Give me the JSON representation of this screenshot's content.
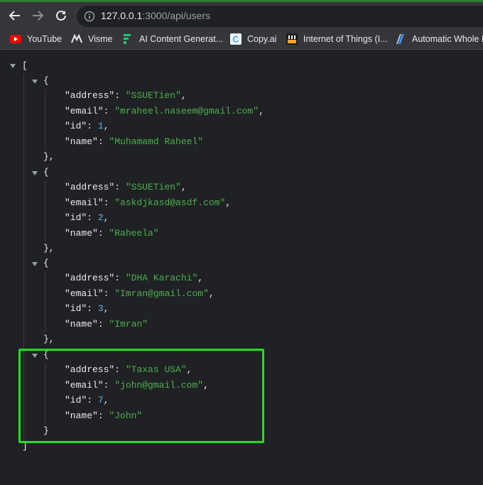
{
  "toolbar": {
    "url_host": "127.0.0.1",
    "url_path": ":3000/api/users"
  },
  "bookmarks": [
    {
      "label": "YouTube",
      "icon": "youtube-icon"
    },
    {
      "label": "Visme",
      "icon": "visme-icon"
    },
    {
      "label": "AI Content Generat...",
      "icon": "ai-content-icon"
    },
    {
      "label": "Copy.ai",
      "icon": "copyai-icon"
    },
    {
      "label": "Internet of Things (I...",
      "icon": "iot-icon"
    },
    {
      "label": "Automatic Whole H",
      "icon": "automatic-icon"
    }
  ],
  "users": [
    {
      "address": "SSUETien",
      "email": "mraheel.naseem@gmail.com",
      "id": "1",
      "name": "Muhamamd Raheel"
    },
    {
      "address": "SSUETien",
      "email": "askdjkasd@asdf.com",
      "id": "2",
      "name": "Raheela"
    },
    {
      "address": "DHA Karachi",
      "email": "Imran@gmail.com",
      "id": "3",
      "name": "Imran"
    },
    {
      "address": "Taxas USA",
      "email": "john@gmail.com",
      "id": "7",
      "name": "John"
    }
  ],
  "colors": {
    "highlight": "#22dd22",
    "string": "#4caf50",
    "number": "#6ab0f3"
  }
}
